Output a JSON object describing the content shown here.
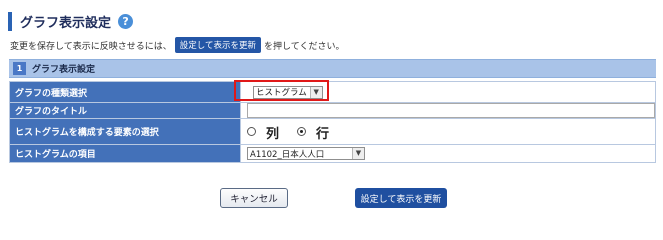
{
  "page": {
    "title": "グラフ表示設定",
    "help_icon": "question-circle-icon",
    "description_before": "変更を保存して表示に反映させるには、",
    "description_button": "設定して表示を更新",
    "description_after": "を押してください。"
  },
  "section": {
    "number": "1",
    "label": "グラフ表示設定"
  },
  "form": {
    "graph_type": {
      "label": "グラフの種類選択",
      "value": "ヒストグラム"
    },
    "graph_title": {
      "label": "グラフのタイトル",
      "value": ""
    },
    "element_choice": {
      "label": "ヒストグラムを構成する要素の選択",
      "options": [
        {
          "label": "列",
          "selected": false
        },
        {
          "label": "行",
          "selected": true
        }
      ]
    },
    "item": {
      "label": "ヒストグラムの項目",
      "value": "A1102_日本人人口"
    }
  },
  "buttons": {
    "cancel": "キャンセル",
    "apply": "設定して表示を更新"
  },
  "colors": {
    "accent": "#2456a6",
    "label_bg": "#4371b9",
    "highlight": "#e01818",
    "section_bg": "#a9c3e8"
  }
}
